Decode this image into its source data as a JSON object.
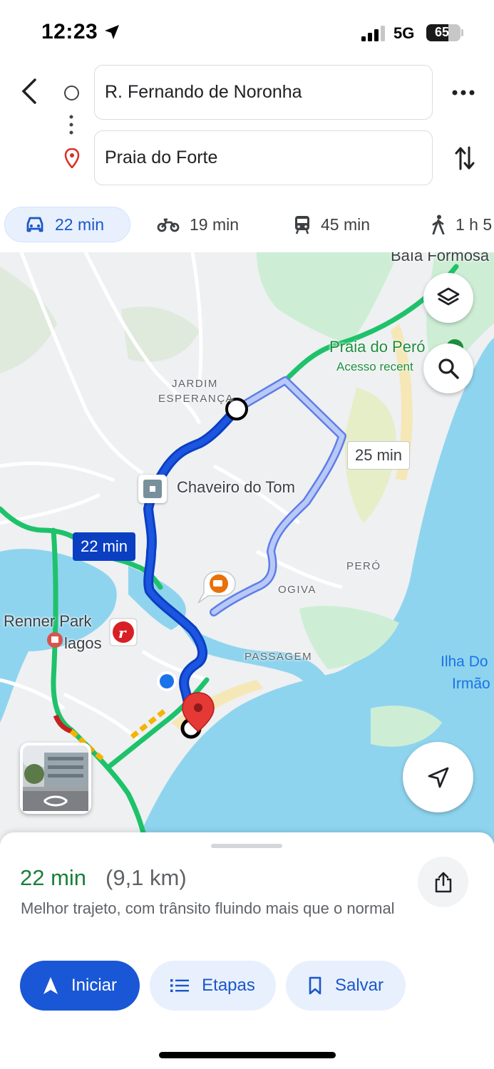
{
  "status_bar": {
    "time": "12:23",
    "network": "5G",
    "battery": "65",
    "battery_level": 0.65
  },
  "directions": {
    "origin": "R. Fernando de Noronha",
    "destination": "Praia do Forte"
  },
  "travel_modes": [
    {
      "icon": "car-icon",
      "label": "22 min",
      "active": true
    },
    {
      "icon": "motorcycle-icon",
      "label": "19 min"
    },
    {
      "icon": "transit-icon",
      "label": "45 min"
    },
    {
      "icon": "walk-icon",
      "label": "1 h 5"
    }
  ],
  "map": {
    "labels": {
      "baia_formosa": "Baía Formosa",
      "praia_do_pero": "Praia do Peró",
      "acesso_recente": "Acesso recent",
      "jardim": "JARDIM",
      "esperanca": "ESPERANÇA",
      "chaveiro": "Chaveiro do Tom",
      "pero": "PERÓ",
      "ogiva": "OGIVA",
      "passagem": "PASSAGEM",
      "renner": "Renner Park",
      "lagos": "lagos",
      "ilha_line1": "Ilha Do",
      "ilha_line2": "Irmão"
    },
    "route_primary_label": "22 min",
    "route_alt_label": "25 min",
    "colors": {
      "route_primary": "#0b3fc2",
      "route_alt": "#8ea5ef",
      "traffic_green": "#1ec26a",
      "water": "#8fd4ee"
    }
  },
  "summary": {
    "eta": "22 min",
    "distance": "(9,1 km)",
    "description": "Melhor trajeto, com trânsito fluindo mais que o normal"
  },
  "actions": {
    "start": "Iniciar",
    "steps": "Etapas",
    "save": "Salvar"
  }
}
